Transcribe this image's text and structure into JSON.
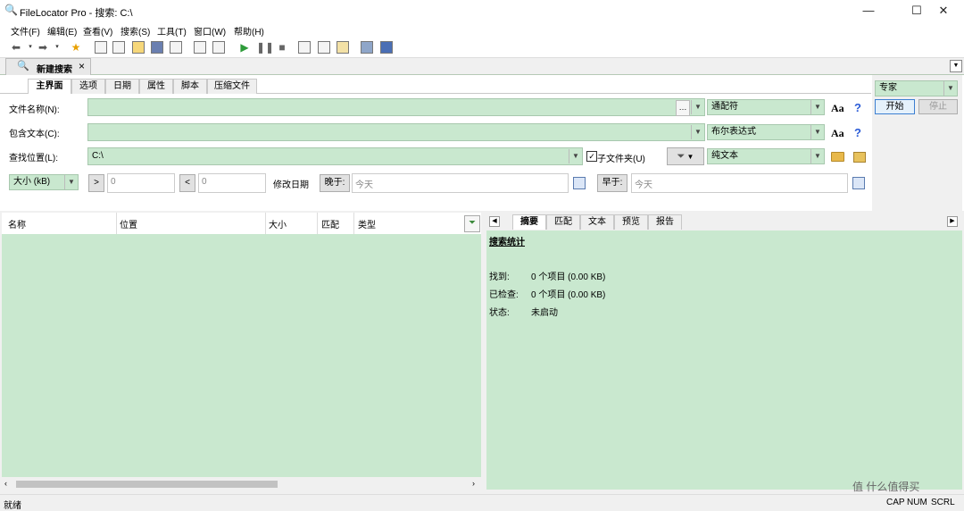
{
  "window": {
    "title": "FileLocator Pro - 搜索: C:\\",
    "controls": {
      "minimize": "—",
      "maximize": "☐",
      "close": "✕"
    }
  },
  "menu": [
    "文件(F)",
    "编辑(E)",
    "查看(V)",
    "搜索(S)",
    "工具(T)",
    "窗口(W)",
    "帮助(H)"
  ],
  "document_tab": {
    "label": "新建搜索",
    "close": "×"
  },
  "sub_tabs": [
    "主界面",
    "选项",
    "日期",
    "属性",
    "脚本",
    "压缩文件"
  ],
  "form": {
    "filename_label": "文件名称(N):",
    "filename_value": "",
    "filename_mode": "通配符",
    "content_label": "包含文本(C):",
    "content_value": "",
    "content_mode": "布尔表达式",
    "location_label": "查找位置(L):",
    "location_value": "C:\\",
    "subfolders_label": "子文件夹(U)",
    "subfolders_checked": true,
    "file_type": "纯文本",
    "case_label": "Aa",
    "help_label": "?",
    "size_unit": "大小 (kB)",
    "gt_label": ">",
    "gt_value": "0",
    "lt_label": "<",
    "lt_value": "0",
    "modified_label": "修改日期",
    "after_label": "晚于:",
    "after_value": "今天",
    "before_label": "早于:",
    "before_value": "今天"
  },
  "side": {
    "mode": "专家",
    "start_label": "开始",
    "stop_label": "停止"
  },
  "results_columns": [
    "名称",
    "位置",
    "大小",
    "匹配",
    "类型"
  ],
  "right_tabs": [
    "摘要",
    "匹配",
    "文本",
    "预览",
    "报告"
  ],
  "summary": {
    "heading": "搜索统计",
    "rows": [
      {
        "label": "找到:",
        "value": "0 个项目 (0.00 KB)"
      },
      {
        "label": "已检查:",
        "value": "0 个项目 (0.00 KB)"
      },
      {
        "label": "状态:",
        "value": "未启动"
      }
    ]
  },
  "status": {
    "text": "就绪",
    "indicators": [
      "CAP",
      "NUM",
      "SCRL"
    ],
    "watermark": "值 什么值得买"
  },
  "colors": {
    "panel_green": "#c9e8cf",
    "accent_border": "#a8c8ae"
  }
}
